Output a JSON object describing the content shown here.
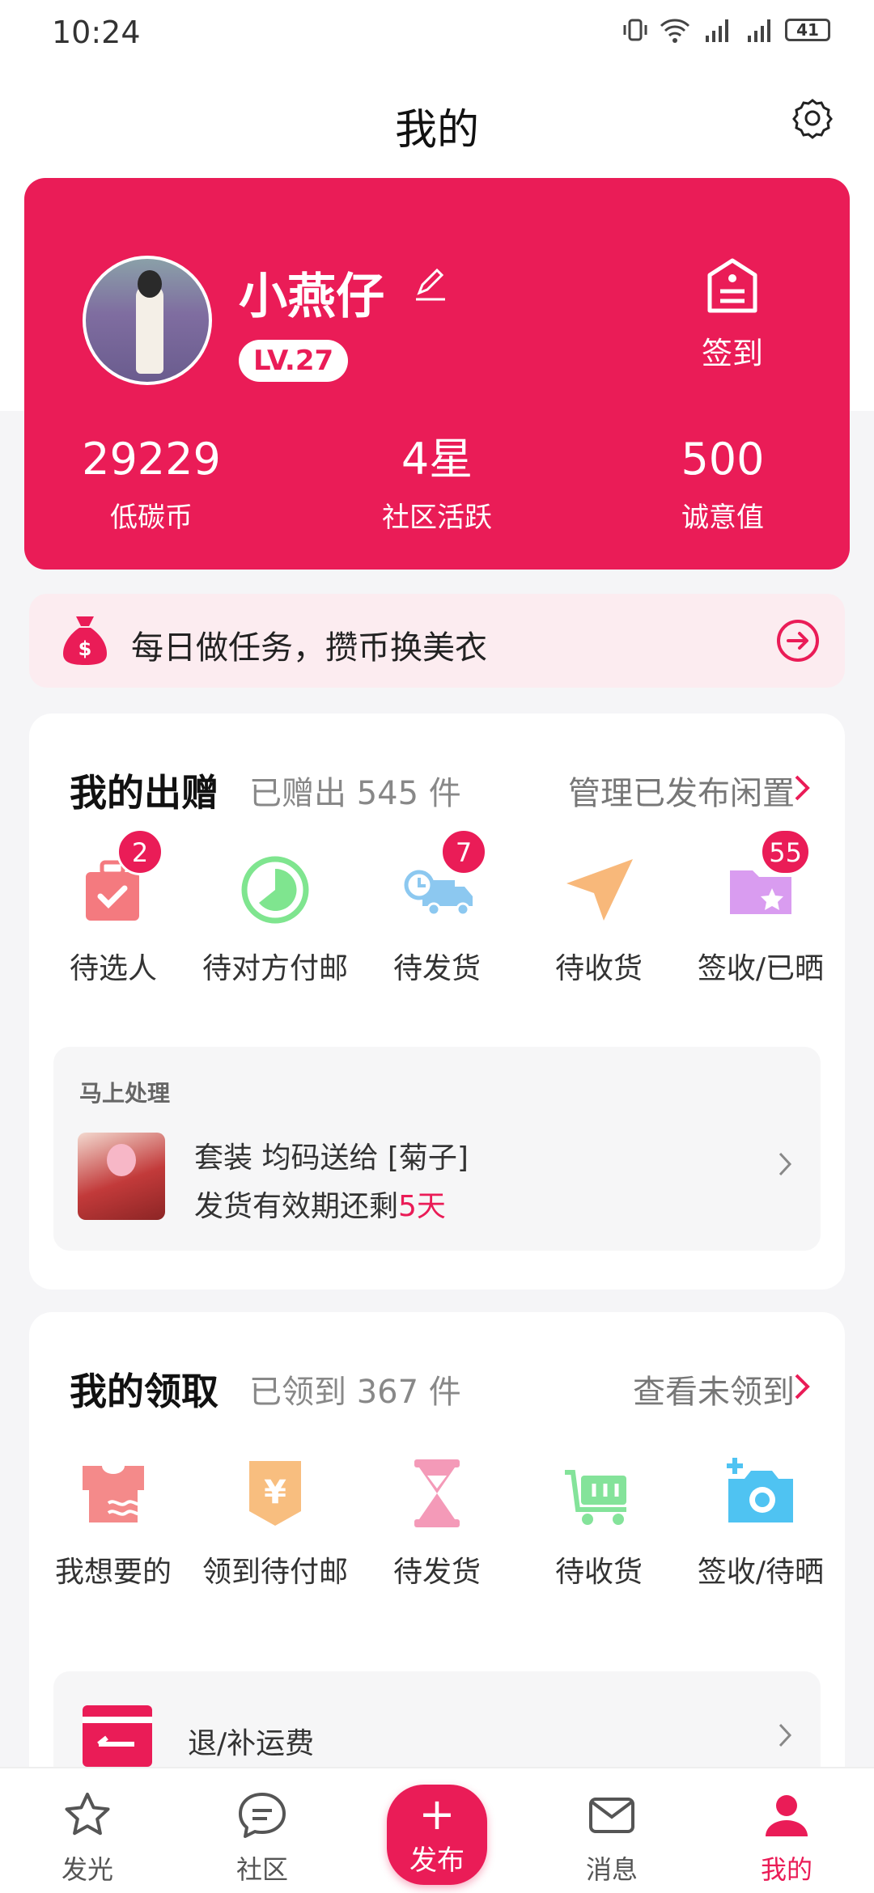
{
  "status_bar": {
    "time": "10:24",
    "battery": "41"
  },
  "header": {
    "title": "我的"
  },
  "profile": {
    "name": "小燕仔",
    "level": "LV.27",
    "signin_label": "签到",
    "stats": [
      {
        "value": "29229",
        "label": "低碳币"
      },
      {
        "value": "4星",
        "label": "社区活跃"
      },
      {
        "value": "500",
        "label": "诚意值"
      }
    ]
  },
  "task_banner": {
    "text": "每日做任务，攒币换美衣"
  },
  "gift_section": {
    "title": "我的出赠",
    "count": "已赠出 545 件",
    "link": "管理已发布闲置",
    "items": [
      {
        "label": "待选人",
        "badge": "2",
        "icon": "suitcase-check-icon",
        "color": "#f47a7f"
      },
      {
        "label": "待对方付邮",
        "badge": "",
        "icon": "clock-circle-icon",
        "color": "#7fe58f"
      },
      {
        "label": "待发货",
        "badge": "7",
        "icon": "delivery-truck-icon",
        "color": "#8cc8f0"
      },
      {
        "label": "待收货",
        "badge": "",
        "icon": "paper-plane-icon",
        "color": "#f8b87a"
      },
      {
        "label": "签收/已晒",
        "badge": "55",
        "icon": "star-folder-icon",
        "color": "#d99cf0"
      }
    ],
    "pending": {
      "heading": "马上处理",
      "title": "套装 均码送给 [菊子]",
      "subtitle_prefix": "发货有效期还剩",
      "days": "5天"
    }
  },
  "receive_section": {
    "title": "我的领取",
    "count": "已领到 367 件",
    "link": "查看未领到",
    "items": [
      {
        "label": "我想要的",
        "icon": "tshirt-icon",
        "color": "#f48a8a"
      },
      {
        "label": "领到待付邮",
        "icon": "yuan-tag-icon",
        "color": "#f8be7f"
      },
      {
        "label": "待发货",
        "icon": "hourglass-icon",
        "color": "#f49ab8"
      },
      {
        "label": "待收货",
        "icon": "cart-box-icon",
        "color": "#84e39a"
      },
      {
        "label": "签收/待晒",
        "icon": "camera-plus-icon",
        "color": "#4fc3f2"
      }
    ],
    "refund_label": "退/补运费"
  },
  "bottom_nav": {
    "items": [
      {
        "label": "发光",
        "icon": "star-icon"
      },
      {
        "label": "社区",
        "icon": "chat-bubble-icon"
      },
      {
        "label": "消息",
        "icon": "mail-icon"
      },
      {
        "label": "我的",
        "icon": "user-icon"
      }
    ],
    "publish_label": "发布"
  },
  "colors": {
    "accent": "#ea1c57",
    "banner_bg": "#fcecf0"
  }
}
